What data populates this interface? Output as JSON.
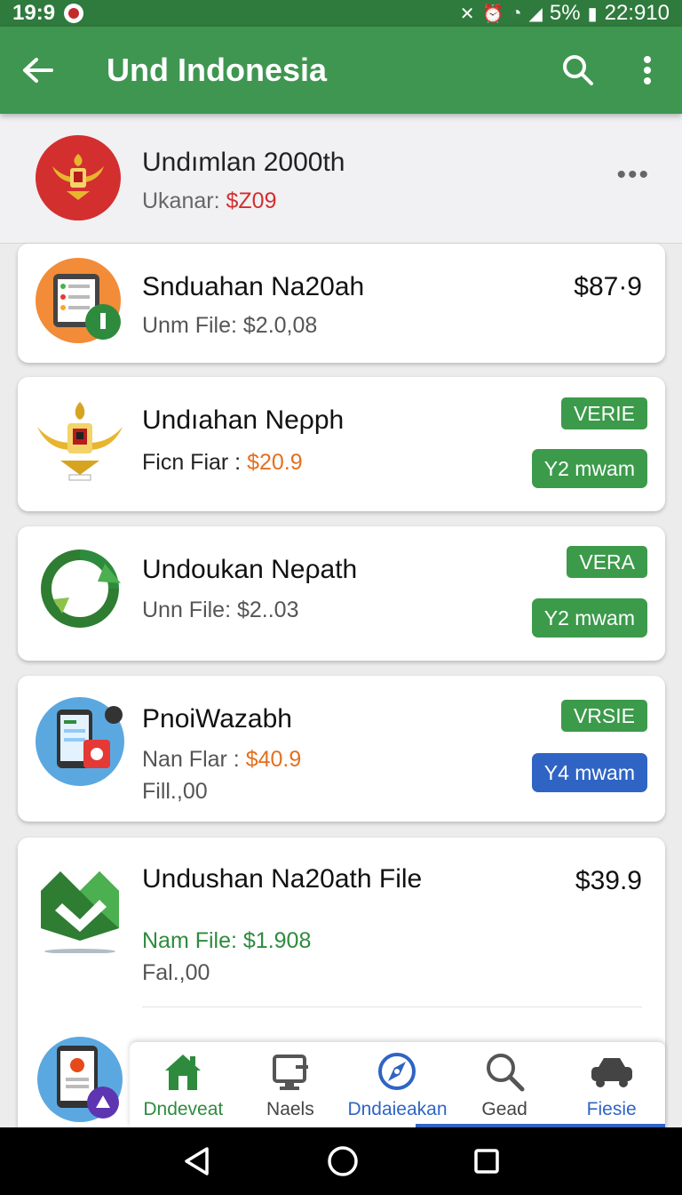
{
  "status_bar": {
    "time": "19:9",
    "battery": "5%",
    "clock": "22:910"
  },
  "app_bar": {
    "title": "Und Indonesia"
  },
  "header": {
    "title": "Undımlan 2000th",
    "sub_label": "Ukanar:",
    "sub_price": "$Z09"
  },
  "cards": [
    {
      "title": "Snduahan Na20ah",
      "sub": "Unm File: $2.0,08",
      "price": "$87·9"
    },
    {
      "title": "Undıahan Neρph",
      "sub_label": "Ficn Fiar :",
      "sub_price": "$20.9",
      "badge": "VERIE",
      "pill": "Y2 mwam"
    },
    {
      "title": "Undoukan Neρath",
      "sub": "Unn File: $2..03",
      "badge": "VERA",
      "pill": "Y2 mwam"
    },
    {
      "title": "PnoiWazabh",
      "sub_label": "Nan Flar :",
      "sub_price": "$40.9",
      "extra": "Fill.,00",
      "badge": "VRSIE",
      "pill": "Y4 mwam"
    },
    {
      "title": "Undushan Na20ath File",
      "sub": "Nam File: $1.908",
      "extra": "Fal.,00",
      "price": "$39.9"
    }
  ],
  "bottom_nav": [
    {
      "label": "Dndeveat",
      "icon": "home-icon"
    },
    {
      "label": "Naels",
      "icon": "monitor-icon"
    },
    {
      "label": "Dndaieakan",
      "icon": "compass-icon"
    },
    {
      "label": "Gead",
      "icon": "search-icon"
    },
    {
      "label": "Fiesie",
      "icon": "car-icon"
    }
  ],
  "colors": {
    "app_bar": "#3f9650",
    "status_bar": "#2f7a3d",
    "badge_green": "#3c9a4b",
    "pill_blue": "#2f64c4",
    "price_red": "#d32f2f",
    "price_orange": "#e4701e"
  }
}
